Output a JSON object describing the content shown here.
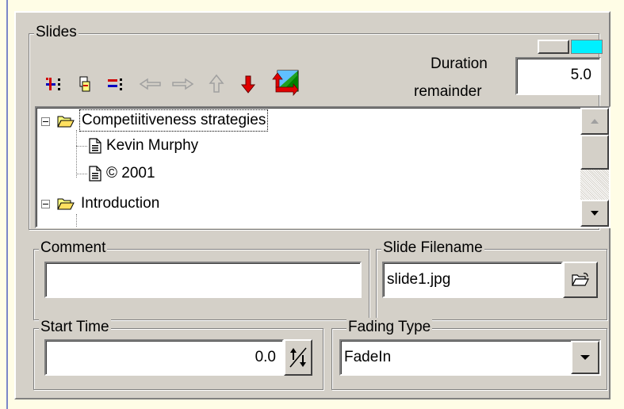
{
  "slides_group": {
    "legend": "Slides",
    "duration_label_line1": "Duration",
    "duration_label_line2": "remainder",
    "duration_value": "5.0"
  },
  "toolbar": {
    "icons": [
      "add-slide-icon",
      "insert-slide-icon",
      "remove-slide-icon",
      "move-left-icon",
      "move-right-icon",
      "move-up-icon",
      "move-down-icon",
      "import-image-icon"
    ]
  },
  "tree": {
    "items": [
      {
        "label": "Competiitiveness strategies",
        "type": "folder",
        "expanded": true,
        "selected": true
      },
      {
        "label": "Kevin Murphy",
        "type": "document"
      },
      {
        "label": "© 2001",
        "type": "document"
      },
      {
        "label": "Introduction",
        "type": "folder",
        "expanded": true
      }
    ]
  },
  "comment": {
    "legend": "Comment",
    "value": ""
  },
  "slide_filename": {
    "legend": "Slide Filename",
    "value": "slide1.jpg"
  },
  "start_time": {
    "legend": "Start Time",
    "value": "0.0"
  },
  "fading_type": {
    "legend": "Fading Type",
    "value": "FadeIn"
  },
  "colors": {
    "panel": "#d4d0c8",
    "background": "#fffde6",
    "cyan_indicator": "#00f0ff",
    "selection": "#000080"
  }
}
